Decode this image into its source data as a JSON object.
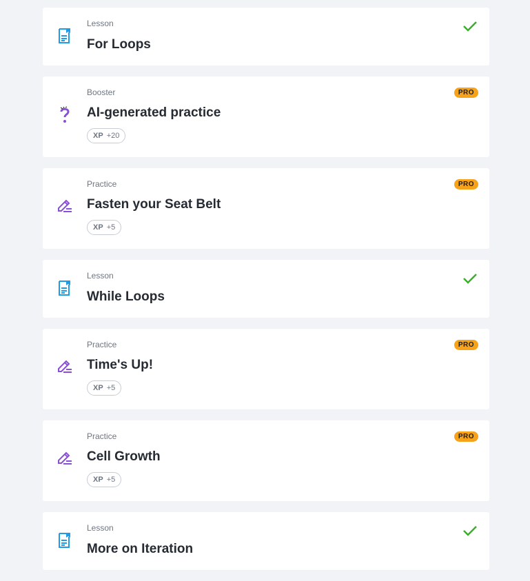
{
  "items": [
    {
      "kind": "Lesson",
      "title": "For Loops",
      "status": "completed",
      "icon": "lesson-doc-icon"
    },
    {
      "kind": "Booster",
      "title": "AI-generated practice",
      "badge": "PRO",
      "xp_label": "XP",
      "xp_value": "+20",
      "icon": "question-mark-icon"
    },
    {
      "kind": "Practice",
      "title": "Fasten your Seat Belt",
      "badge": "PRO",
      "xp_label": "XP",
      "xp_value": "+5",
      "icon": "pencil-icon"
    },
    {
      "kind": "Lesson",
      "title": "While Loops",
      "status": "completed",
      "icon": "lesson-doc-icon"
    },
    {
      "kind": "Practice",
      "title": "Time's Up!",
      "badge": "PRO",
      "xp_label": "XP",
      "xp_value": "+5",
      "icon": "pencil-icon"
    },
    {
      "kind": "Practice",
      "title": "Cell Growth",
      "badge": "PRO",
      "xp_label": "XP",
      "xp_value": "+5",
      "icon": "pencil-icon"
    },
    {
      "kind": "Lesson",
      "title": "More on Iteration",
      "status": "completed",
      "icon": "lesson-doc-icon"
    }
  ],
  "colors": {
    "background": "#f1f3f6",
    "lesson_icon": "#1e9ce8",
    "practice_icon": "#8a4fd8",
    "pro_badge": "#f7a21b",
    "check": "#3aae2a"
  }
}
